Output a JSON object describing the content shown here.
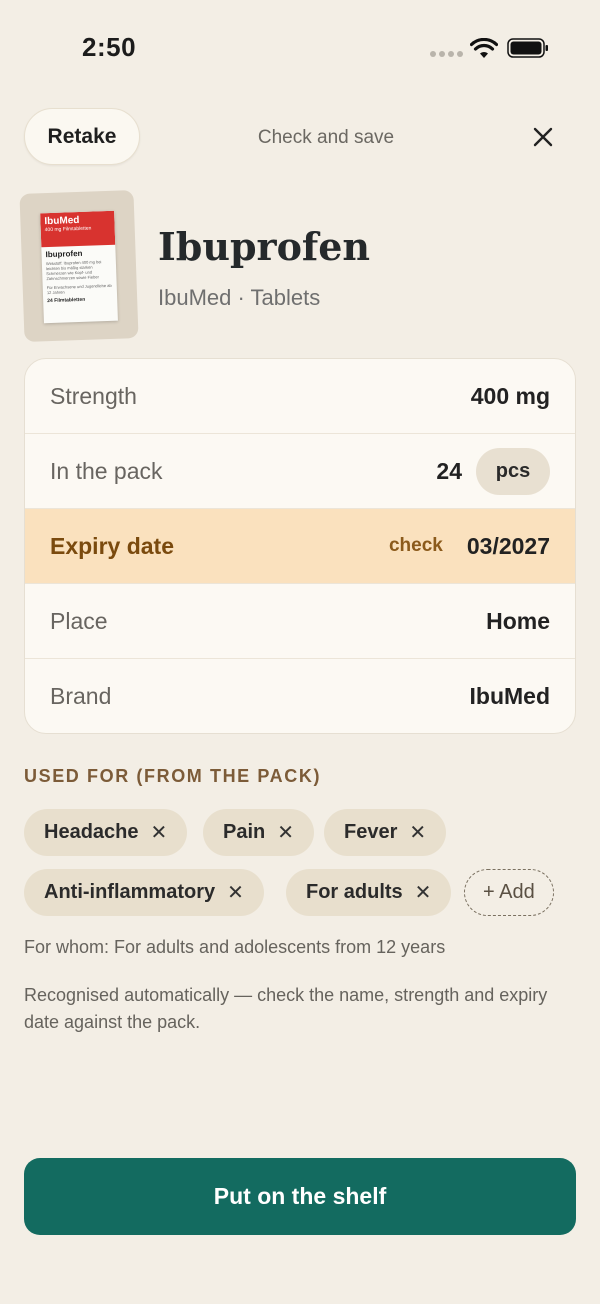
{
  "status_bar": {
    "time": "2:50"
  },
  "header": {
    "retake_label": "Retake",
    "title": "Check and save"
  },
  "pack_image": {
    "brand": "IbuMed",
    "strength_line": "400 mg Filmtabletten",
    "name": "Ibuprofen",
    "text": "Wirkstoff: Ibuprofen 400 mg bei leichten bis mäßig starken Schmerzen wie Kopf- und Zahnschmerzen sowie Fieber",
    "text2": "Für Erwachsene und Jugendliche ab 12 Jahren",
    "count": "24 Filmtabletten"
  },
  "product": {
    "name": "Ibuprofen",
    "subtitle": "IbuMed · Tablets"
  },
  "details": {
    "strength": {
      "label": "Strength",
      "value": "400 mg"
    },
    "pack": {
      "label": "In the pack",
      "value": "24",
      "unit": "pcs"
    },
    "expiry": {
      "label": "Expiry date",
      "hint": "check",
      "value": "03/2027"
    },
    "place": {
      "label": "Place",
      "value": "Home"
    },
    "brand": {
      "label": "Brand",
      "value": "IbuMed"
    }
  },
  "used_for": {
    "title": "USED FOR (FROM THE PACK)",
    "tags": [
      "Headache",
      "Pain",
      "Fever",
      "Anti-inflammatory",
      "For adults"
    ],
    "add_label": "+ Add"
  },
  "notes": {
    "for_whom": "For whom: For adults and adolescents from 12 years",
    "recognised": "Recognised automatically — check the name, strength and expiry date against the pack."
  },
  "cta": {
    "label": "Put on the shelf"
  },
  "colors": {
    "background": "#f3eee5",
    "accent": "#136b60",
    "expiry_highlight": "#fae1be",
    "chip": "#e8dfcd"
  }
}
